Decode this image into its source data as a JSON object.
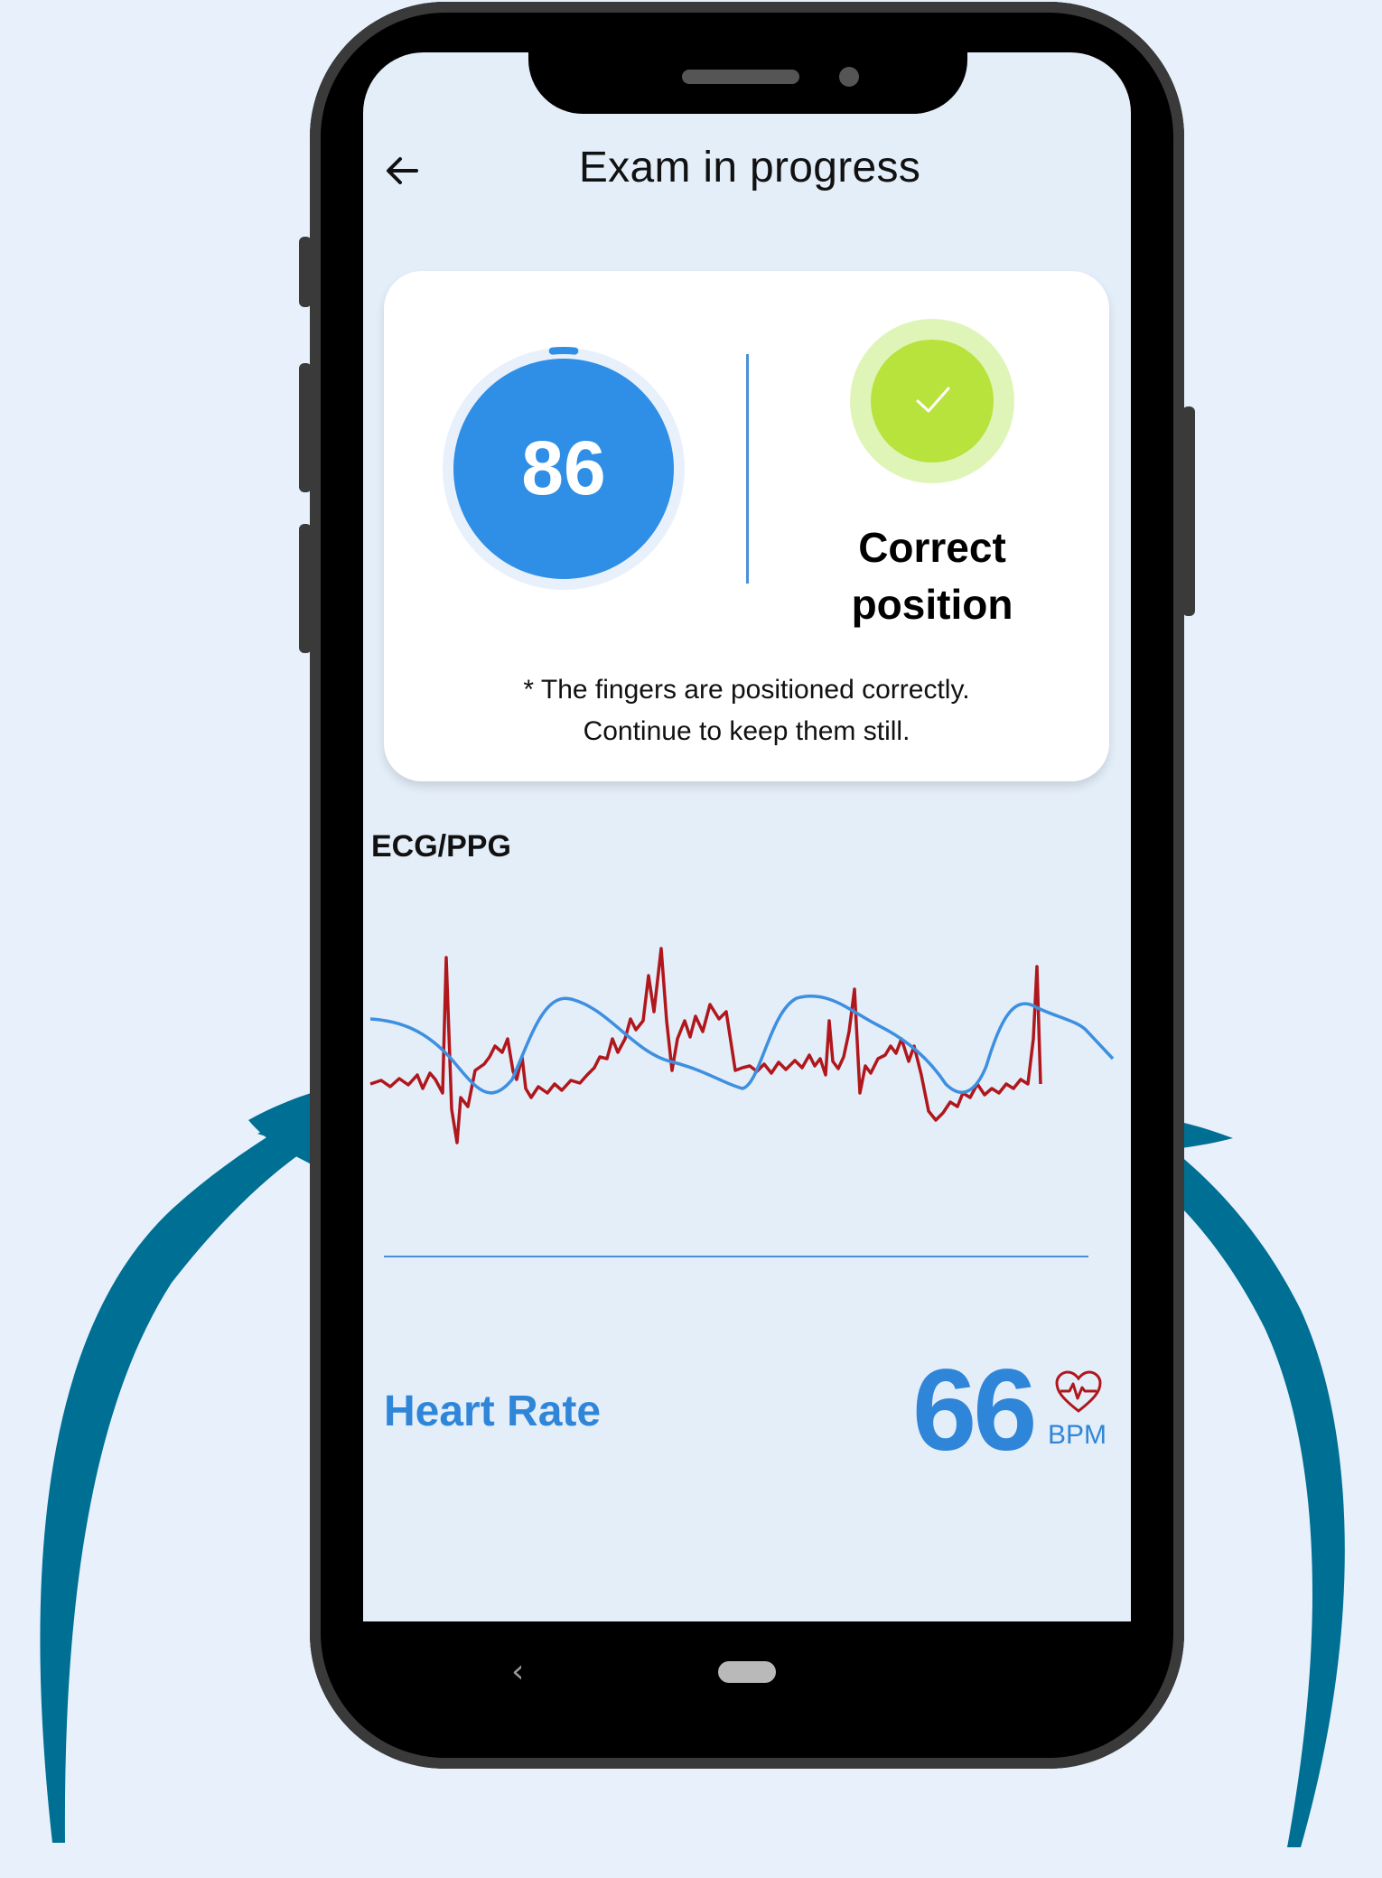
{
  "header": {
    "title": "Exam in progress",
    "back_icon": "arrow-left-icon"
  },
  "status_card": {
    "progress_value": "86",
    "progress_fraction": 0.03,
    "status_title": "Correct\nposition",
    "status_message": "* The fingers are positioned correctly.\nContinue to keep them still.",
    "status_icon": "checkmark-icon"
  },
  "chart": {
    "title": "ECG/PPG"
  },
  "heart_rate": {
    "label": "Heart Rate",
    "value": "66",
    "unit": "BPM",
    "icon": "heart-pulse-icon"
  },
  "system_nav": {
    "back_glyph": "‹"
  },
  "colors": {
    "background": "#e8f1fb",
    "screen": "#e4eef9",
    "accent_blue": "#2f86d9",
    "ecg_red": "#b0171c",
    "ppg_blue": "#3d8fe0",
    "check_green": "#b8e23c",
    "arrow_teal": "#006f94"
  }
}
